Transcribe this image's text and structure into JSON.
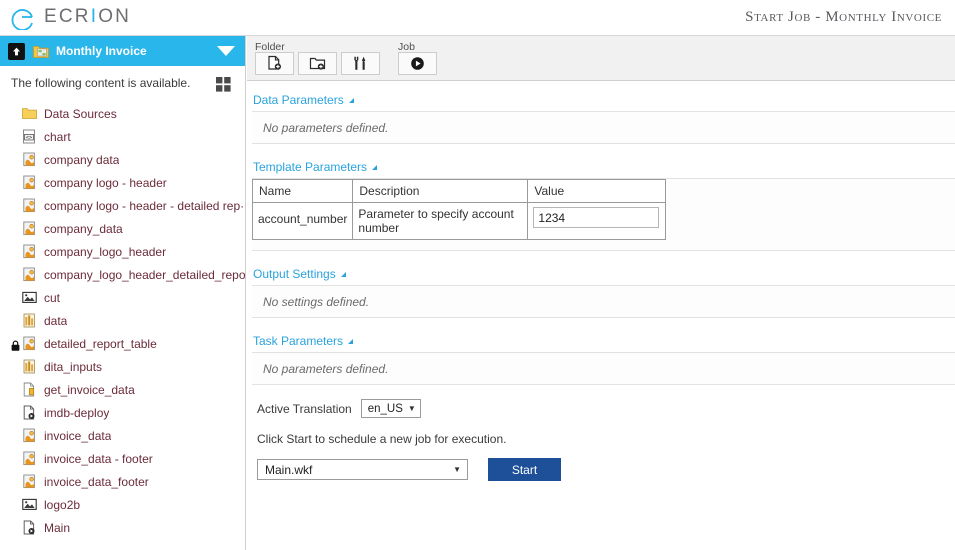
{
  "brand": {
    "name": "ECRION",
    "highlight_letter": "I"
  },
  "header": {
    "title": "Start Job - Monthly Invoice"
  },
  "sidebar": {
    "header": {
      "title": "Monthly Invoice",
      "up_icon": "up-arrow-icon",
      "folder_icon": "folder-template-icon",
      "collapse_icon": "chevron-down-icon"
    },
    "subheader": {
      "text": "The following content is available.",
      "view_icon": "grid-view-icon"
    },
    "items": [
      {
        "label": "Data Sources",
        "icon": "folder-icon",
        "locked": false
      },
      {
        "label": "chart",
        "icon": "code-file-icon",
        "locked": false
      },
      {
        "label": "company data",
        "icon": "template-file-icon",
        "locked": false
      },
      {
        "label": "company logo - header",
        "icon": "template-file-icon",
        "locked": false
      },
      {
        "label": "company logo - header - detailed rep···",
        "icon": "template-file-icon",
        "locked": false
      },
      {
        "label": "company_data",
        "icon": "template-file-icon",
        "locked": false
      },
      {
        "label": "company_logo_header",
        "icon": "template-file-icon",
        "locked": false
      },
      {
        "label": "company_logo_header_detailed_report",
        "icon": "template-file-icon",
        "locked": false
      },
      {
        "label": "cut",
        "icon": "image-file-icon",
        "locked": false
      },
      {
        "label": "data",
        "icon": "data-file-icon",
        "locked": false
      },
      {
        "label": "detailed_report_table",
        "icon": "template-file-icon",
        "locked": true
      },
      {
        "label": "dita_inputs",
        "icon": "data-file-icon",
        "locked": false
      },
      {
        "label": "get_invoice_data",
        "icon": "script-file-icon",
        "locked": false
      },
      {
        "label": "imdb-deploy",
        "icon": "workflow-file-icon",
        "locked": false
      },
      {
        "label": "invoice_data",
        "icon": "template-file-icon",
        "locked": false
      },
      {
        "label": "invoice_data - footer",
        "icon": "template-file-icon",
        "locked": false
      },
      {
        "label": "invoice_data_footer",
        "icon": "template-file-icon",
        "locked": false
      },
      {
        "label": "logo2b",
        "icon": "image-file-icon",
        "locked": false
      },
      {
        "label": "Main",
        "icon": "workflow-file-icon",
        "locked": false
      }
    ]
  },
  "toolbar": {
    "groups": [
      {
        "label": "Folder",
        "buttons": [
          {
            "name": "new-file-button",
            "icon": "new-file-icon"
          },
          {
            "name": "new-folder-button",
            "icon": "new-folder-icon"
          },
          {
            "name": "folder-settings-button",
            "icon": "tools-icon"
          }
        ]
      },
      {
        "label": "Job",
        "buttons": [
          {
            "name": "run-job-button",
            "icon": "play-icon"
          }
        ]
      }
    ]
  },
  "sections": {
    "data_parameters": {
      "title": "Data Parameters",
      "empty_text": "No parameters defined."
    },
    "template_parameters": {
      "title": "Template Parameters",
      "columns": [
        "Name",
        "Description",
        "Value"
      ],
      "rows": [
        {
          "name": "account_number",
          "description": "Parameter to specify account number",
          "value": "1234"
        }
      ]
    },
    "output_settings": {
      "title": "Output Settings",
      "empty_text": "No settings defined."
    },
    "task_parameters": {
      "title": "Task Parameters",
      "empty_text": "No parameters defined."
    }
  },
  "footer": {
    "translation_label": "Active Translation",
    "translation_value": "en_US",
    "hint": "Click Start to schedule a new job for execution.",
    "workflow_value": "Main.wkf",
    "start_label": "Start"
  },
  "colors": {
    "accent": "#29b6ea",
    "section_header": "#29a3dd",
    "start_button": "#1e4f99",
    "tree_label": "#6b2b3a"
  }
}
